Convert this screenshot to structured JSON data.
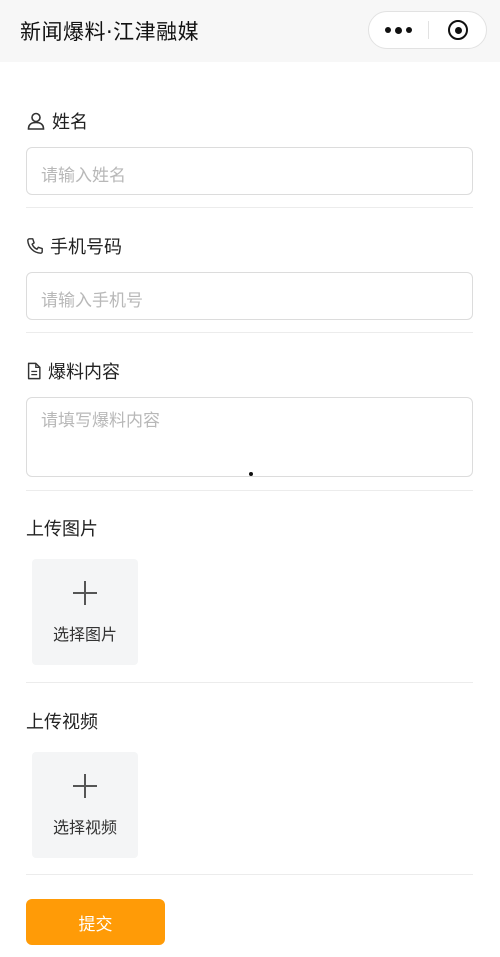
{
  "header": {
    "title": "新闻爆料·江津融媒",
    "more_icon": "more-dots-icon",
    "close_icon": "target-icon"
  },
  "form": {
    "name": {
      "label": "姓名",
      "placeholder": "请输入姓名",
      "icon": "person-icon"
    },
    "phone": {
      "label": "手机号码",
      "placeholder": "请输入手机号",
      "icon": "phone-icon"
    },
    "content": {
      "label": "爆料内容",
      "placeholder": "请填写爆料内容",
      "icon": "document-icon"
    },
    "image_upload": {
      "label": "上传图片",
      "button": "选择图片",
      "icon": "plus-icon"
    },
    "video_upload": {
      "label": "上传视频",
      "button": "选择视频",
      "icon": "plus-icon"
    },
    "submit_label": "提交"
  },
  "colors": {
    "accent": "#ff9b07",
    "placeholder": "#b8b8b8",
    "border": "#dcdcdc",
    "topbar": "#f7f7f7"
  }
}
